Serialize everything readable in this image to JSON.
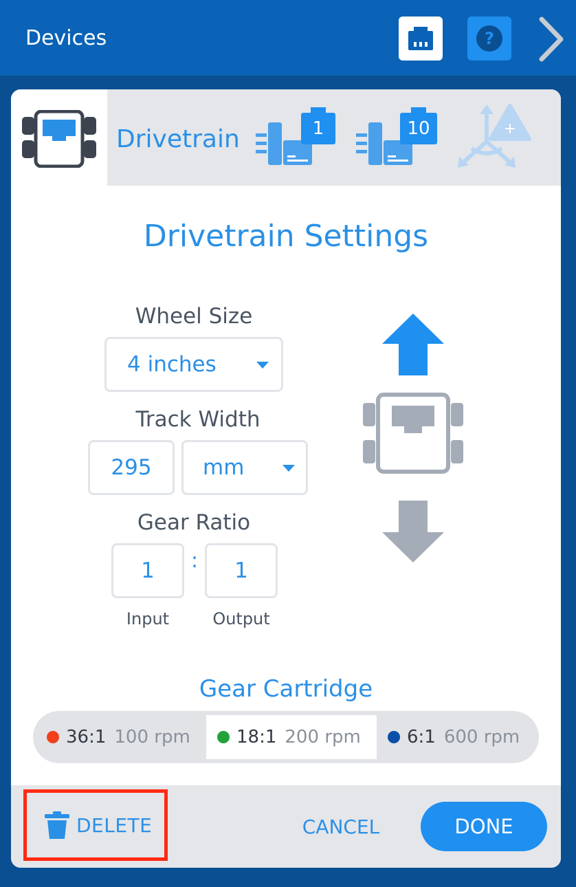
{
  "header": {
    "title": "Devices",
    "port_icon": "port-icon",
    "help_icon": "help-icon",
    "next_icon": "chevron-right-icon"
  },
  "tabs": [
    {
      "label": "Drivetrain",
      "icon": "drivetrain-icon",
      "active": true
    },
    {
      "badge": "1",
      "icon": "motor-icon"
    },
    {
      "badge": "10",
      "icon": "motor-icon"
    },
    {
      "icon": "gyro-add-icon"
    }
  ],
  "settings": {
    "title": "Drivetrain Settings",
    "wheel_size": {
      "label": "Wheel Size",
      "value": "4 inches"
    },
    "track_width": {
      "label": "Track Width",
      "value": "295",
      "unit": "mm"
    },
    "gear_ratio": {
      "label": "Gear Ratio",
      "input": "1",
      "separator": ":",
      "output": "1",
      "input_label": "Input",
      "output_label": "Output"
    }
  },
  "cartridge": {
    "title": "Gear Cartridge",
    "options": [
      {
        "ratio": "36:1",
        "rpm": "100 rpm",
        "color": "#f0401e",
        "selected": false
      },
      {
        "ratio": "18:1",
        "rpm": "200 rpm",
        "color": "#22a33a",
        "selected": true
      },
      {
        "ratio": "6:1",
        "rpm": "600 rpm",
        "color": "#0b4fa8",
        "selected": false
      }
    ]
  },
  "footer": {
    "delete_label": "DELETE",
    "cancel_label": "CANCEL",
    "done_label": "DONE"
  },
  "colors": {
    "accent": "#1f8ff0",
    "header_bg": "#0a63b6",
    "highlight_border": "#ff2a12"
  }
}
